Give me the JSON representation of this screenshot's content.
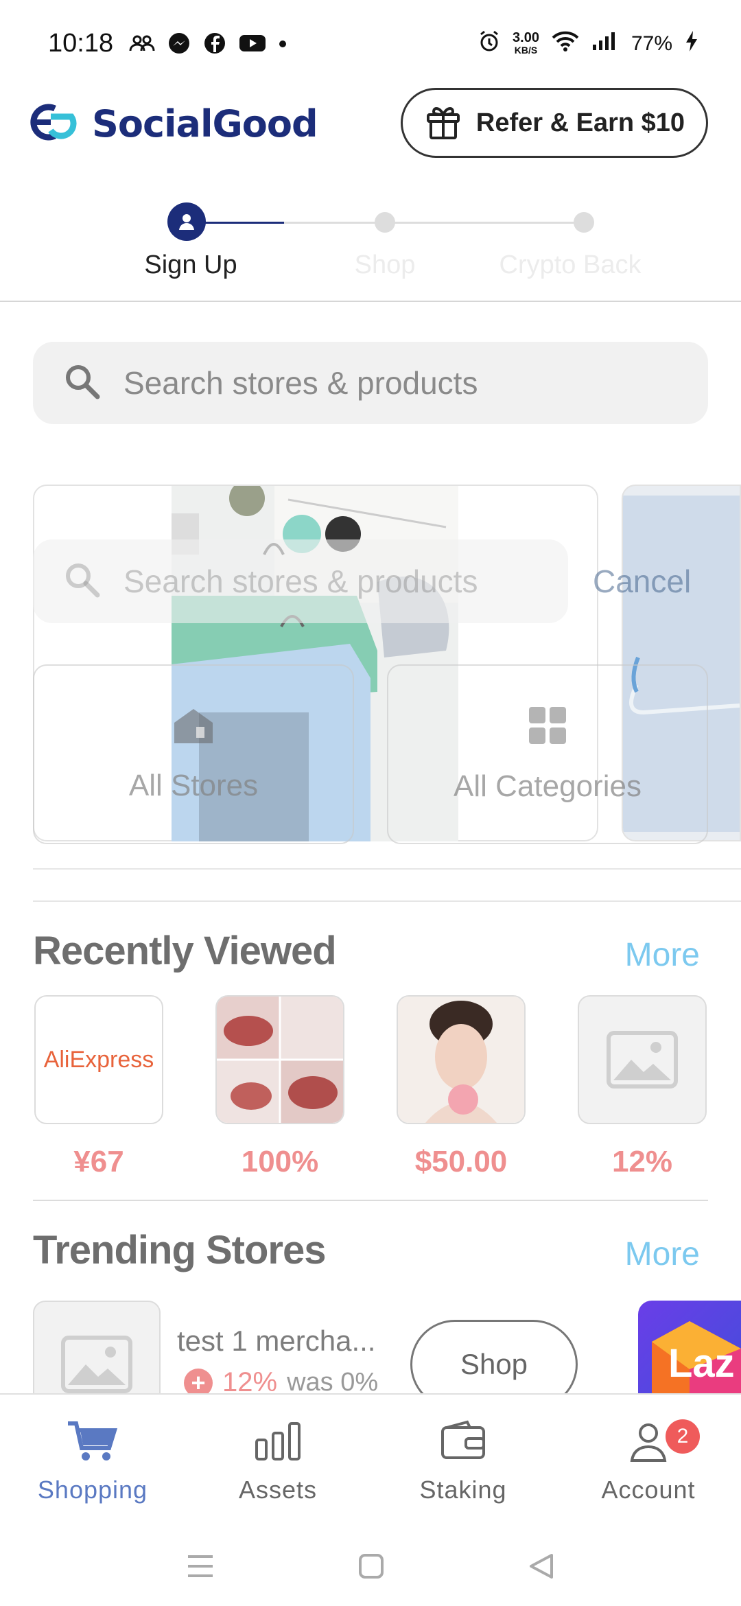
{
  "status_bar": {
    "time": "10:18",
    "net_speed_value": "3.00",
    "net_speed_unit": "KB/S",
    "battery": "77%",
    "left_icons": [
      "group-icon",
      "messenger-icon",
      "facebook-icon",
      "youtube-icon",
      "dot-icon"
    ],
    "right_icons": [
      "alarm-icon",
      "wifi-icon",
      "signal-icon",
      "charging-icon"
    ]
  },
  "header": {
    "brand": "SocialGood",
    "refer_label": "Refer & Earn $10"
  },
  "steps": [
    {
      "label": "Sign Up",
      "state": "active"
    },
    {
      "label": "Shop",
      "state": "inactive"
    },
    {
      "label": "Crypto Back",
      "state": "inactive"
    }
  ],
  "search": {
    "placeholder": "Search stores & products"
  },
  "overlay": {
    "search_placeholder": "Search stores & products",
    "cancel_label": "Cancel",
    "all_stores": "All Stores",
    "all_categories": "All Categories"
  },
  "recently_viewed": {
    "title": "Recently Viewed",
    "more": "More",
    "items": [
      {
        "brand": "AliExpress",
        "value": "¥67"
      },
      {
        "value": "100%"
      },
      {
        "value": "$50.00"
      },
      {
        "value": "12%"
      }
    ]
  },
  "trending": {
    "title": "Trending Stores",
    "more": "More",
    "store_name": "test 1 mercha...",
    "rate": "12%",
    "was": "was 0%",
    "shop_label": "Shop",
    "laz_label": "Laz"
  },
  "bottom_nav": {
    "items": [
      {
        "label": "Shopping",
        "icon": "cart-icon",
        "active": true
      },
      {
        "label": "Assets",
        "icon": "bar-chart-icon",
        "active": false
      },
      {
        "label": "Staking",
        "icon": "wallet-icon",
        "active": false
      },
      {
        "label": "Account",
        "icon": "person-icon",
        "active": false,
        "badge": "2"
      }
    ]
  },
  "colors": {
    "brand_navy": "#1c2d7a",
    "accent_blue": "#7cc9ef",
    "price_red": "#ef8f8f",
    "active_nav": "#5a79c2"
  }
}
